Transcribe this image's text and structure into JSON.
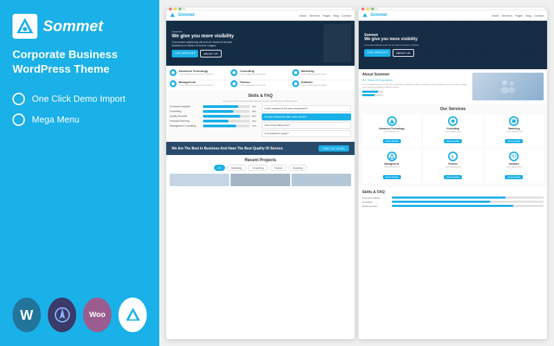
{
  "left": {
    "logo_text": "Sommet",
    "theme_title_line1": "Corporate Business",
    "theme_title_line2": "WordPress Theme",
    "features": [
      {
        "label": "One Click Demo Import"
      },
      {
        "label": "Mega Menu"
      }
    ],
    "badges": [
      {
        "id": "wp",
        "label": "W",
        "tooltip": "WordPress"
      },
      {
        "id": "avada",
        "label": "⌀",
        "tooltip": "Avada"
      },
      {
        "id": "woo",
        "label": "Woo",
        "tooltip": "WooCommerce"
      },
      {
        "id": "summit",
        "label": "▲",
        "tooltip": "Summit"
      }
    ]
  },
  "preview1": {
    "nav_logo": "Sommet",
    "nav_links": [
      "About",
      "Services",
      "Pages",
      "Blog",
      "Contact"
    ],
    "hero_title": "We give you more visibility",
    "hero_brand": "Sommet",
    "hero_desc": "Connected adipiscing elit sed do eiusmod tempor incididunt ut labore et dolore magna",
    "hero_btn1": "OUR SERVICES",
    "hero_btn2": "ABOUT US",
    "features": [
      {
        "title": "Advanced Technology",
        "desc": "Lorem adipiscing elit sed do eiusmod tempor"
      },
      {
        "title": "Consulting",
        "desc": "Lorem adipiscing elit sed do eiusmod"
      },
      {
        "title": "Marketing",
        "desc": "Lorem adipiscing elit sed do eiusmod"
      },
      {
        "title": "Management",
        "desc": "Lorem adipiscing elit sed do eiusmod tempor"
      },
      {
        "title": "Finance",
        "desc": "Lorem adipiscing elit sed do eiusmod"
      },
      {
        "title": "Software",
        "desc": "Lorem adipiscing elit sed do eiusmod"
      }
    ],
    "skills_title": "Skills & FAQ",
    "skills_subtitle": "Lorem ipsum dolor sit amet consectetur adipiscing elit sed do eiusmod tempor incididunt ut labore",
    "skills": [
      {
        "label": "Consumer analysis",
        "pct": 75
      },
      {
        "label": "Consulting",
        "pct": 65
      },
      {
        "label": "Quality Services",
        "pct": 80
      },
      {
        "label": "Financial Planning",
        "pct": 55
      },
      {
        "label": "Management Consulting",
        "pct": 70
      }
    ],
    "faq": [
      {
        "q": "Is this included in the sales department?",
        "active": false
      },
      {
        "q": "Do you conduct the after sales service?",
        "active": true
      },
      {
        "q": "How is the billing done?",
        "active": false
      },
      {
        "q": "Is it required to quote?",
        "active": false
      }
    ],
    "cta_text": "We Are The Best In Business And Have The Best Quality Of Service.",
    "cta_btn": "FIND OUT MORE",
    "projects_title": "Recent Projects",
    "project_tags": [
      "All",
      "Marketing",
      "Consulting",
      "Finance",
      "Branding"
    ]
  },
  "preview2": {
    "nav_logo": "Sommet",
    "hero_title": "Sommet",
    "hero_subtitle": "We give you more visibility",
    "hero_desc": "Connected adipiscing elit sed do eiusmod tempor incididunt",
    "hero_btn1": "OUR SERVICES",
    "hero_btn2": "ABOUT US",
    "about_title": "About Sommet",
    "about_years": "20+ Years Of Experience",
    "about_desc": "Lorem adipiscing elit sed do eiusmod tempor incididunt ut labore et dolore magna aliqua ut enim ad minim veniam quis nostrud exercitation ullamco laboris",
    "services_title": "Our Services",
    "services": [
      {
        "name": "Advanced Technology",
        "desc": "Lorem adipiscing elit sed do"
      },
      {
        "name": "Consulting",
        "desc": "Lorem adipiscing elit sed do"
      },
      {
        "name": "Marketing",
        "desc": "Lorem adipiscing elit sed do"
      },
      {
        "name": "Management",
        "desc": "Lorem adipiscing elit sed do"
      },
      {
        "name": "Finance",
        "desc": "Lorem adipiscing elit sed do"
      },
      {
        "name": "Software",
        "desc": "Lorem adipiscing elit sed do"
      }
    ],
    "skills_title": "Skills & FAQ",
    "skills": [
      {
        "label": "Consumer analysis",
        "pct": 75
      },
      {
        "label": "Consulting",
        "pct": 65
      },
      {
        "label": "Quality Services",
        "pct": 80
      }
    ]
  },
  "colors": {
    "primary": "#1ab0e8",
    "dark_blue": "#2a4a6b",
    "wp_blue": "#21759b",
    "avada_dark": "#3a3a6b",
    "woo_purple": "#9b5c8f"
  }
}
